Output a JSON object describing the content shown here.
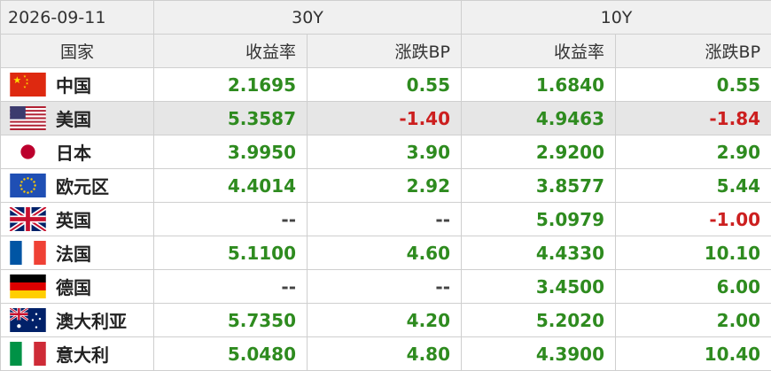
{
  "header": {
    "date": "2026-09-11",
    "group_30y": "30Y",
    "group_10y": "10Y",
    "country_col": "国家",
    "yield_label": "收益率",
    "change_label": "涨跌BP"
  },
  "colors": {
    "positive": "#2e8b1f",
    "negative": "#cc1f1f",
    "header_bg": "#f0f0f0",
    "highlight_row": "#e6e6e6"
  },
  "rows": [
    {
      "country": "中国",
      "flag": "china-flag-icon",
      "y30": "2.1695",
      "c30": "0.55",
      "y10": "1.6840",
      "c10": "0.55"
    },
    {
      "country": "美国",
      "flag": "usa-flag-icon",
      "y30": "5.3587",
      "c30": "-1.40",
      "y10": "4.9463",
      "c10": "-1.84"
    },
    {
      "country": "日本",
      "flag": "japan-flag-icon",
      "y30": "3.9950",
      "c30": "3.90",
      "y10": "2.9200",
      "c10": "2.90"
    },
    {
      "country": "欧元区",
      "flag": "eu-flag-icon",
      "y30": "4.4014",
      "c30": "2.92",
      "y10": "3.8577",
      "c10": "5.44"
    },
    {
      "country": "英国",
      "flag": "uk-flag-icon",
      "y30": "--",
      "c30": "--",
      "y10": "5.0979",
      "c10": "-1.00"
    },
    {
      "country": "法国",
      "flag": "france-flag-icon",
      "y30": "5.1100",
      "c30": "4.60",
      "y10": "4.4330",
      "c10": "10.10"
    },
    {
      "country": "德国",
      "flag": "germany-flag-icon",
      "y30": "--",
      "c30": "--",
      "y10": "3.4500",
      "c10": "6.00"
    },
    {
      "country": "澳大利亚",
      "flag": "australia-flag-icon",
      "y30": "5.7350",
      "c30": "4.20",
      "y10": "5.2020",
      "c10": "2.00"
    },
    {
      "country": "意大利",
      "flag": "italy-flag-icon",
      "y30": "5.0480",
      "c30": "4.80",
      "y10": "4.3900",
      "c10": "10.40"
    }
  ]
}
